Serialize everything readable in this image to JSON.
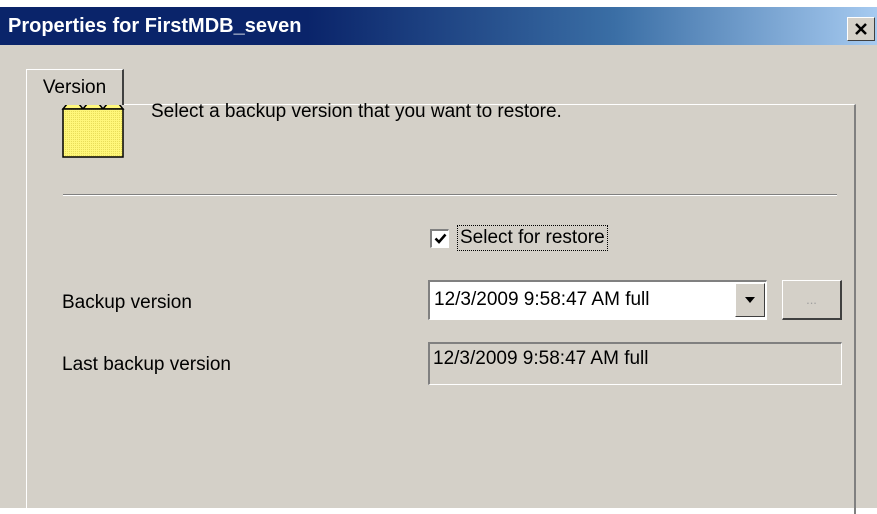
{
  "window": {
    "title": "Properties for FirstMDB_seven",
    "close_symbol": "✕"
  },
  "tabs": [
    {
      "label": "Version",
      "active": true
    }
  ],
  "panel": {
    "icon": "folder-icon",
    "instruction": "Select a backup version that you want to restore.",
    "select_for_restore": {
      "label": "Select for restore",
      "checked": true
    },
    "backup_version": {
      "label": "Backup version",
      "selected": "12/3/2009 9:58:47 AM full"
    },
    "browse_button": {
      "label": "...",
      "enabled": false
    },
    "last_backup_version": {
      "label": "Last backup version",
      "value": "12/3/2009 9:58:47 AM full"
    }
  },
  "colors": {
    "titlebar_start": "#0a246a",
    "titlebar_end": "#a6caf0",
    "dialog_bg": "#d4d0c8",
    "folder_fill": "#fff77a"
  }
}
